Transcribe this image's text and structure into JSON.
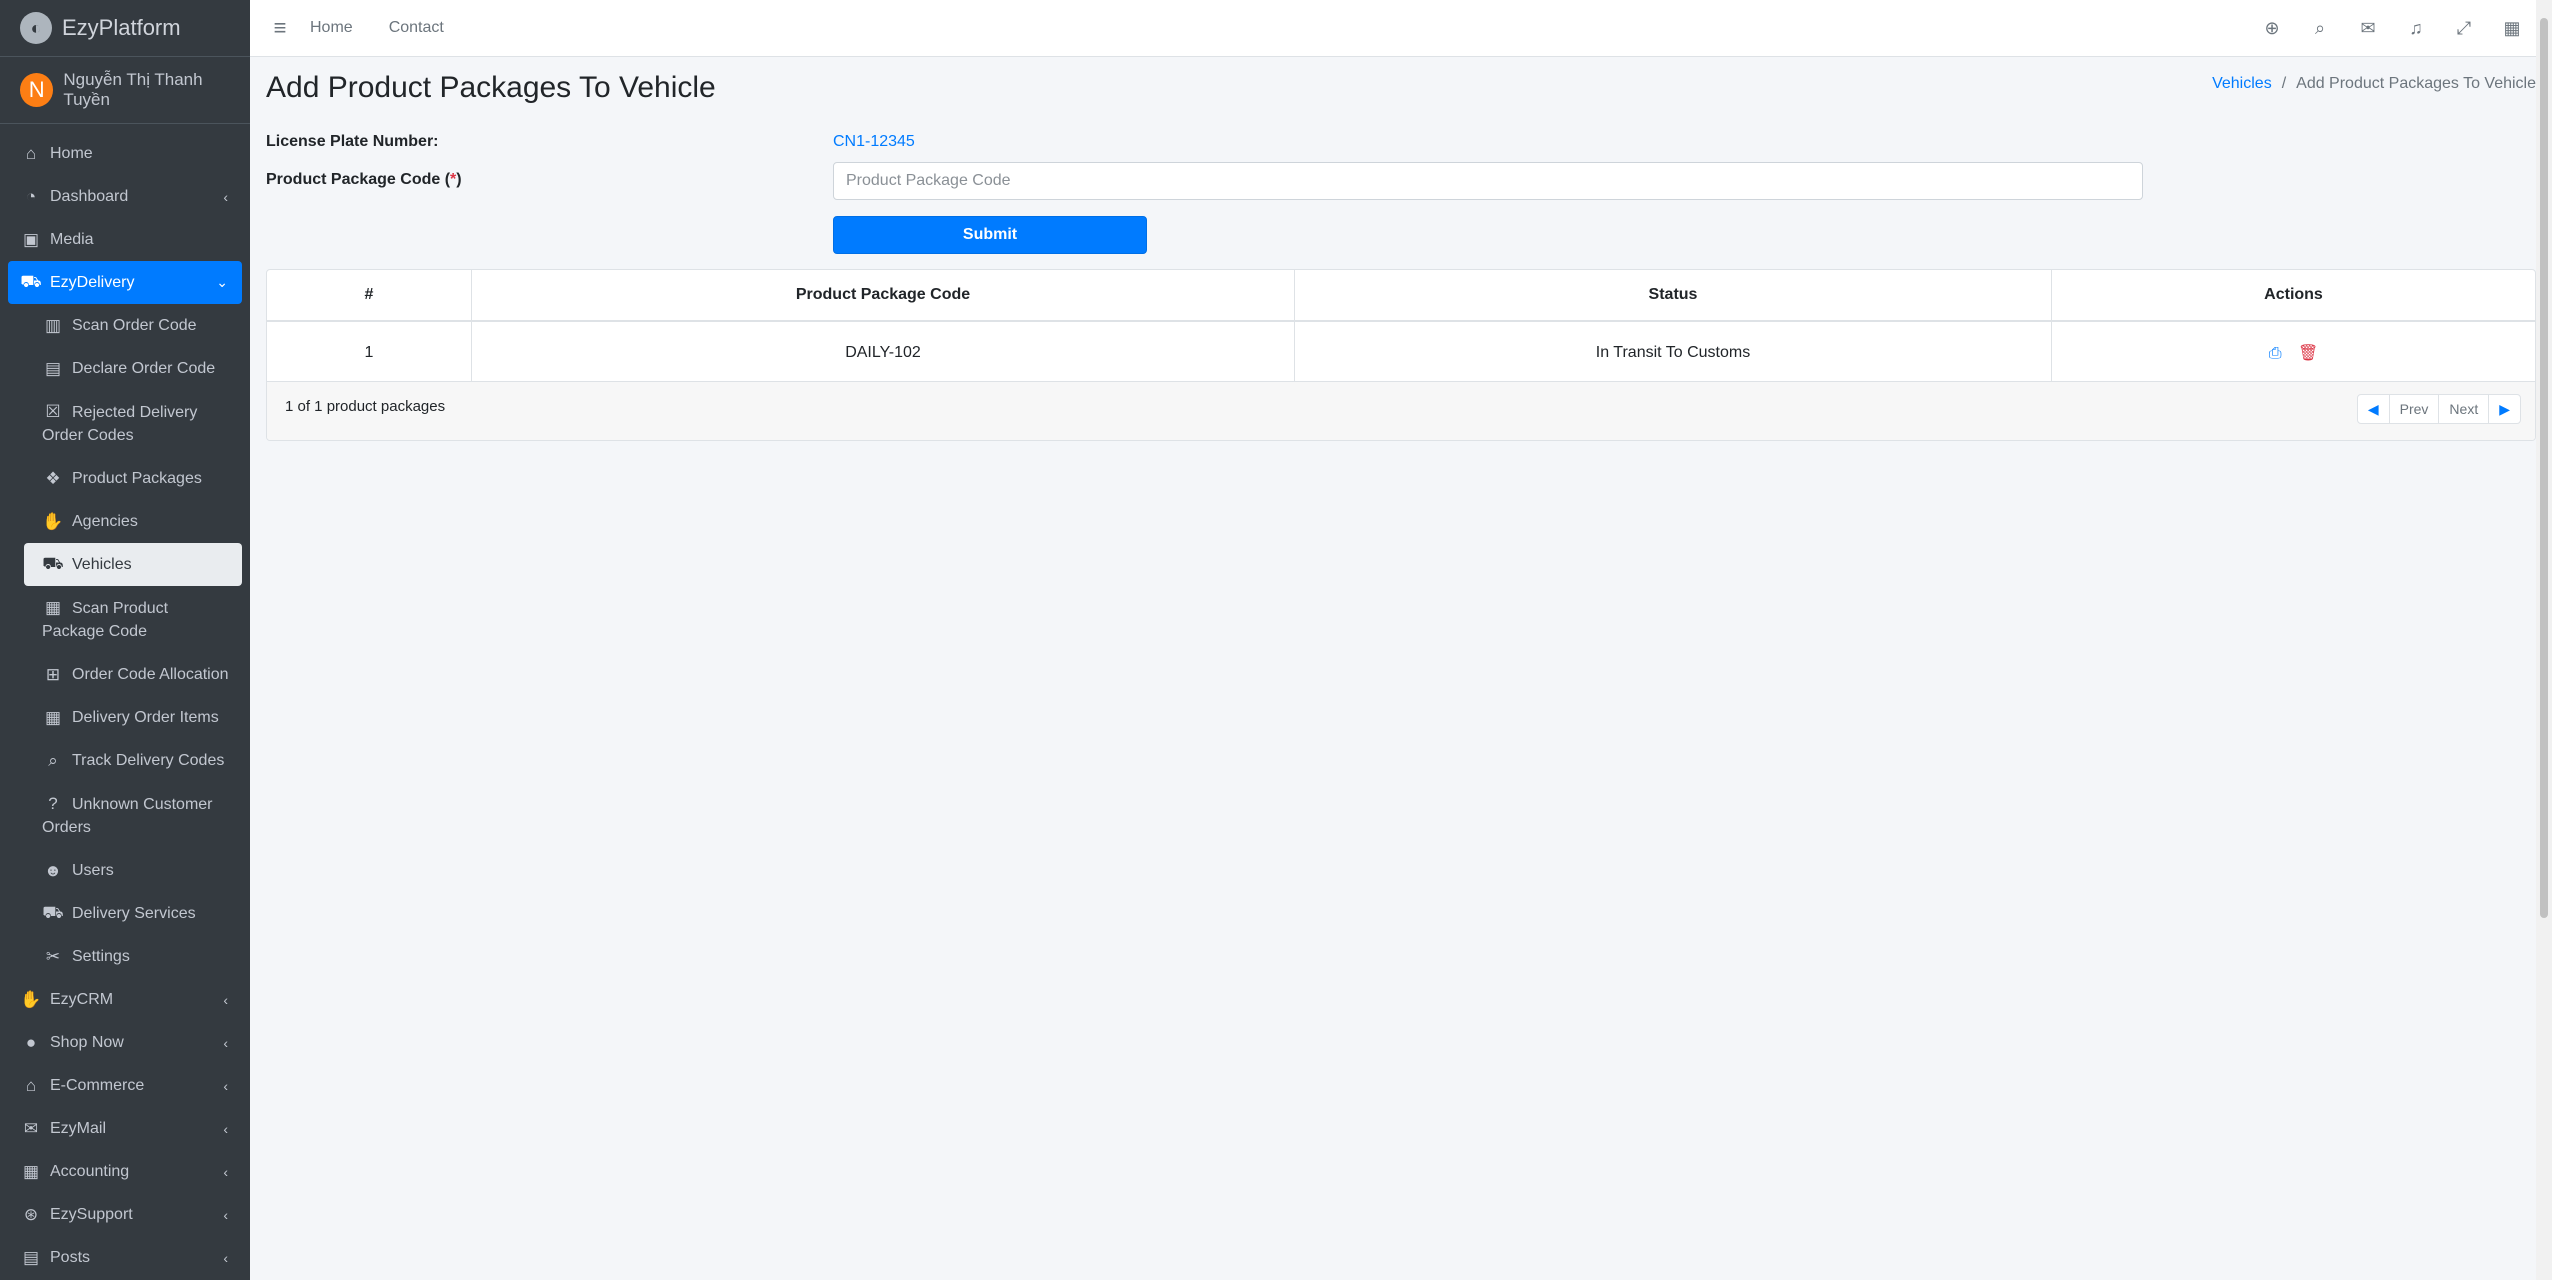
{
  "brand": {
    "name": "EzyPlatform",
    "logo_glyph": "◐"
  },
  "user": {
    "initial": "N",
    "name": "Nguyễn Thị Thanh Tuyền"
  },
  "sidebar": {
    "items": [
      {
        "label": "Home",
        "icon": "home-icon",
        "glyph": "⌂"
      },
      {
        "label": "Dashboard",
        "icon": "dashboard-icon",
        "glyph": "◔"
      },
      {
        "label": "Media",
        "icon": "image-icon",
        "glyph": "▣"
      },
      {
        "label": "EzyDelivery",
        "icon": "truck-icon",
        "glyph": "⛟"
      }
    ],
    "sub_items": [
      {
        "label": "Scan Order Code",
        "icon": "barcode-icon",
        "glyph": "▥"
      },
      {
        "label": "Declare Order Code",
        "icon": "file-icon",
        "glyph": "▤"
      },
      {
        "label": "Rejected Delivery Order Codes",
        "icon": "rejected-icon",
        "glyph": "☒"
      },
      {
        "label": "Product Packages",
        "icon": "boxes-icon",
        "glyph": "❖"
      },
      {
        "label": "Agencies",
        "icon": "handshake-icon",
        "glyph": "✋"
      },
      {
        "label": "Vehicles",
        "icon": "car-icon",
        "glyph": "⛟"
      },
      {
        "label": "Scan Product Package Code",
        "icon": "qr-icon",
        "glyph": "▦"
      },
      {
        "label": "Order Code Allocation",
        "icon": "sitemap-icon",
        "glyph": "⊞"
      },
      {
        "label": "Delivery Order Items",
        "icon": "grid-icon",
        "glyph": "▦"
      },
      {
        "label": "Track Delivery Codes",
        "icon": "search-icon",
        "glyph": "⌕"
      },
      {
        "label": "Unknown Customer Orders",
        "icon": "question-icon",
        "glyph": "?"
      },
      {
        "label": "Users",
        "icon": "users-icon",
        "glyph": "☻"
      },
      {
        "label": "Delivery Services",
        "icon": "truck-icon",
        "glyph": "⛟"
      },
      {
        "label": "Settings",
        "icon": "tools-icon",
        "glyph": "✂"
      }
    ],
    "more_items": [
      {
        "label": "EzyCRM",
        "icon": "handshake-icon",
        "glyph": "✋"
      },
      {
        "label": "Shop Now",
        "icon": "circle-icon",
        "glyph": "●"
      },
      {
        "label": "E-Commerce",
        "icon": "basket-icon",
        "glyph": "⌂"
      },
      {
        "label": "EzyMail",
        "icon": "envelope-icon",
        "glyph": "✉"
      },
      {
        "label": "Accounting",
        "icon": "calculator-icon",
        "glyph": "▦"
      },
      {
        "label": "EzySupport",
        "icon": "lifering-icon",
        "glyph": "⊛"
      },
      {
        "label": "Posts",
        "icon": "newspaper-icon",
        "glyph": "▤"
      }
    ]
  },
  "topbar": {
    "links": [
      "Home",
      "Contact"
    ],
    "icons": [
      {
        "name": "globe-icon",
        "glyph": "⊕"
      },
      {
        "name": "search-icon",
        "glyph": "⌕"
      },
      {
        "name": "comments-icon",
        "glyph": "✉"
      },
      {
        "name": "bell-icon",
        "glyph": "♫"
      },
      {
        "name": "expand-icon",
        "glyph": "⤢"
      },
      {
        "name": "apps-icon",
        "glyph": "▦"
      }
    ]
  },
  "page": {
    "title": "Add Product Packages To Vehicle",
    "breadcrumb": {
      "link": "Vehicles",
      "separator": "/",
      "current": "Add Product Packages To Vehicle"
    }
  },
  "form": {
    "plate_label": "License Plate Number:",
    "plate_value": "CN1-12345",
    "code_label": "Product Package Code (",
    "code_required": "*",
    "code_label_end": ")",
    "code_placeholder": "Product Package Code",
    "code_value": "",
    "submit_label": "Submit"
  },
  "table": {
    "columns": [
      "#",
      "Product Package Code",
      "Status",
      "Actions"
    ],
    "rows": [
      {
        "index": "1",
        "code": "DAILY-102",
        "status": "In Transit To Customs"
      }
    ],
    "summary": "1 of 1 product packages",
    "pager": {
      "prev_label": "Prev",
      "next_label": "Next"
    }
  },
  "colors": {
    "accent": "#007bff",
    "danger": "#dc3545",
    "sidebar_bg": "#343a40",
    "avatar": "#fd7e14"
  }
}
